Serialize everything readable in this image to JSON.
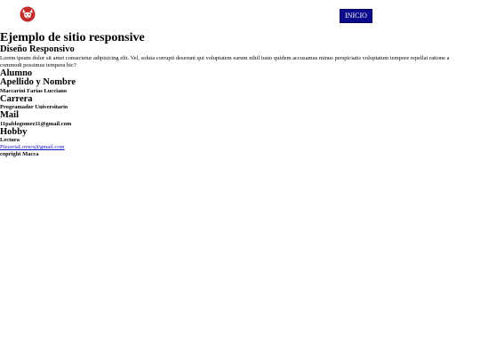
{
  "header": {
    "logo_icon": "red-cat-face-icon",
    "nav_button": "INICIO",
    "nav_color": "#0a0a8c"
  },
  "main": {
    "title": "Ejemplo de sitio responsive",
    "subtitle": "Diseño Responsivo",
    "lorem": "Lorem ipsum dolor sit amet consectetur adipisicing elit. Vel, soluta corrupti deserunt qui voluptatem earum nihil iusto quidem accusamus minus perspiciatis voluptatum tempore repellat ratione a commodi possimus tempora hic?",
    "alumno_heading": "Alumno",
    "fields": [
      {
        "label": "Apellido y Nombre",
        "value": "Maccarini Farias Lucciano"
      },
      {
        "label": "Carrera",
        "value": "Programador Universitario"
      },
      {
        "label": "Mail",
        "value": "11pablogomez11@gmail.com"
      },
      {
        "label": "Hobby",
        "value": "Lectura"
      }
    ],
    "email_link": "PizzeriaLovers@gmail.com",
    "copyright": "copright Macca"
  }
}
